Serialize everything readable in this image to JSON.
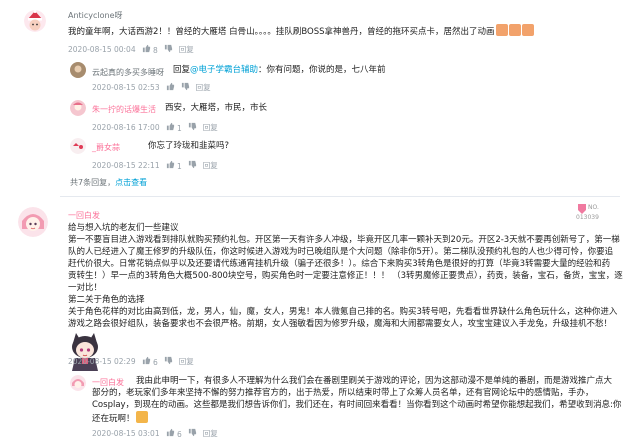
{
  "comments": [
    {
      "user": "Anticyclone呀",
      "line1": "我的童年啊，大话西游2！！曾经的大雁塔 白骨山。。。。挂队刷BOSS拿神兽丹，曾经的拖环买点卡，居然出了动画",
      "time": "2020-08-15 00:04",
      "likes": "8",
      "reply": "回复"
    }
  ],
  "replies": [
    {
      "user": "云起真的多买多睡呀",
      "prefix": "回复",
      "mention": "@电子学霸台辅助",
      "text": "：你有问题，你说的是，七八年前",
      "time": "2020-08-15 02:53",
      "likes": "",
      "reply": "回复"
    },
    {
      "user": "朱一拧的话爆生活",
      "text": "西安，大雁塔，市民，市长",
      "time": "2020-08-16 17:00",
      "likes": "1",
      "reply": "回复"
    },
    {
      "user": "_爵女蒜",
      "text": "你忘了玲珑和韭菜吗?",
      "time": "2020-08-15 22:11",
      "likes": "1",
      "reply": "回复"
    }
  ],
  "more_replies": {
    "count_text": "共7条回复，",
    "link": "点击查看"
  },
  "comment2": {
    "user": "一回白发",
    "badge_line1": "NO.",
    "badge_line2": "013039",
    "lines": [
      "给与想入坑的老友们一些建议",
      "第一不要盲目进入游戏看到排队就购买预约礼包。开区第一天有许多人冲级，毕竟开区几率一颗补天到20元。开区2-3天就不要再创新号了，第一梯",
      "队的人已经进入了魔王修罗的升级队伍，你这时候进入游戏为时已晚组队是个大问题（除非你5开）。第二梯队没预约礼包的人也少得可怜，你要追",
      "赶代价很大。日常花销点似乎以及还要请代练通宵挂机升级（骗子还很多！）。综合下来购买3转角色是很好的打算（毕竟3转需要大量的经验和药",
      "贡转生！）早一点的3转角色大概500-800块空号，购买角色时一定要注意修正！！！ （3转男魔修正要贵点），药贡，装备，宝石，备货，宝宝，逐",
      "一对比！",
      "第二关于角色的选择",
      "关于角色花样的对比由高到低，龙，男人，仙，魔，女人，男鬼！本人微氪自己排的名。购买3转号吧，先看看世界缺什么角色玩什么，这种你进入",
      "游戏之路会很好组队，装备要求也不会很严格。前期，女人强敏看因为修罗升级，魔海和大闹都需要女人，攻宝宝建议入手龙兔，升级挂机不愁！"
    ],
    "time": "2020-08-15 02:29",
    "likes": "6",
    "reply": "回复"
  },
  "reply2": {
    "user": "一回白发",
    "lines": [
      "我由此申明一下，有很多人不理解为什么我们会在番剧里刷关于游戏的评论，因为这部动漫不是单纯的番剧，而是游戏推广点大",
      "部分的，老玩家们多年来坚持不懈的努力推荐官方的，出于热爱，所以结束时带上了众筹人员名单，还有官网论坛中的感情贴，手办，",
      "Cosplay，到现在的动画。这些都是我们想告诉你们，我们还在，有时间回来看看！当你看到这个动画时希望你能想起我们，希望收到消息:你",
      "还在玩啊！"
    ],
    "emote_after": true,
    "time": "2020-08-15 03:01",
    "likes": "6",
    "reply": "回复"
  },
  "icons": {
    "like": "thumbs-up-icon",
    "dislike": "thumbs-down-icon"
  }
}
